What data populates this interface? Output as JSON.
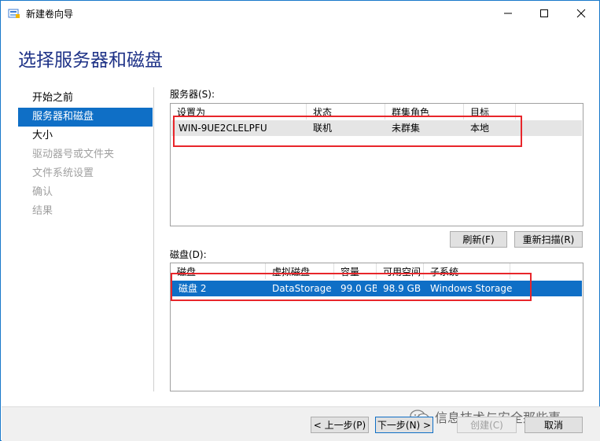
{
  "window": {
    "title": "新建卷向导",
    "controls": {
      "minimize": "minimize",
      "maximize": "maximize",
      "close": "close"
    }
  },
  "header": {
    "title": "选择服务器和磁盘"
  },
  "nav": {
    "items": [
      {
        "label": "开始之前",
        "state": "normal"
      },
      {
        "label": "服务器和磁盘",
        "state": "active"
      },
      {
        "label": "大小",
        "state": "normal"
      },
      {
        "label": "驱动器号或文件夹",
        "state": "disabled"
      },
      {
        "label": "文件系统设置",
        "state": "disabled"
      },
      {
        "label": "确认",
        "state": "disabled"
      },
      {
        "label": "结果",
        "state": "disabled"
      }
    ]
  },
  "servers": {
    "label": "服务器(S):",
    "columns": [
      "设置为",
      "状态",
      "群集角色",
      "目标"
    ],
    "rows": [
      {
        "name": "WIN-9UE2CLELPFU",
        "status": "联机",
        "cluster_role": "未群集",
        "destination": "本地"
      }
    ]
  },
  "buttons": {
    "refresh": "刷新(F)",
    "rescan": "重新扫描(R)",
    "prev": "< 上一步(P)",
    "next": "下一步(N) >",
    "create": "创建(C)",
    "cancel": "取消"
  },
  "disks": {
    "label": "磁盘(D):",
    "columns": [
      "磁盘",
      "虚拟磁盘",
      "容量",
      "可用空间",
      "子系统"
    ],
    "rows": [
      {
        "disk": "磁盘 2",
        "virtual_disk": "DataStorage",
        "capacity": "99.0 GB",
        "free_space": "98.9 GB",
        "subsystem": "Windows Storage"
      }
    ]
  },
  "watermark": {
    "text": "信息技术与安全那些事"
  },
  "colors": {
    "accent": "#0f6fc6",
    "highlight_box": "#e8262b",
    "title": "#1e3287"
  }
}
